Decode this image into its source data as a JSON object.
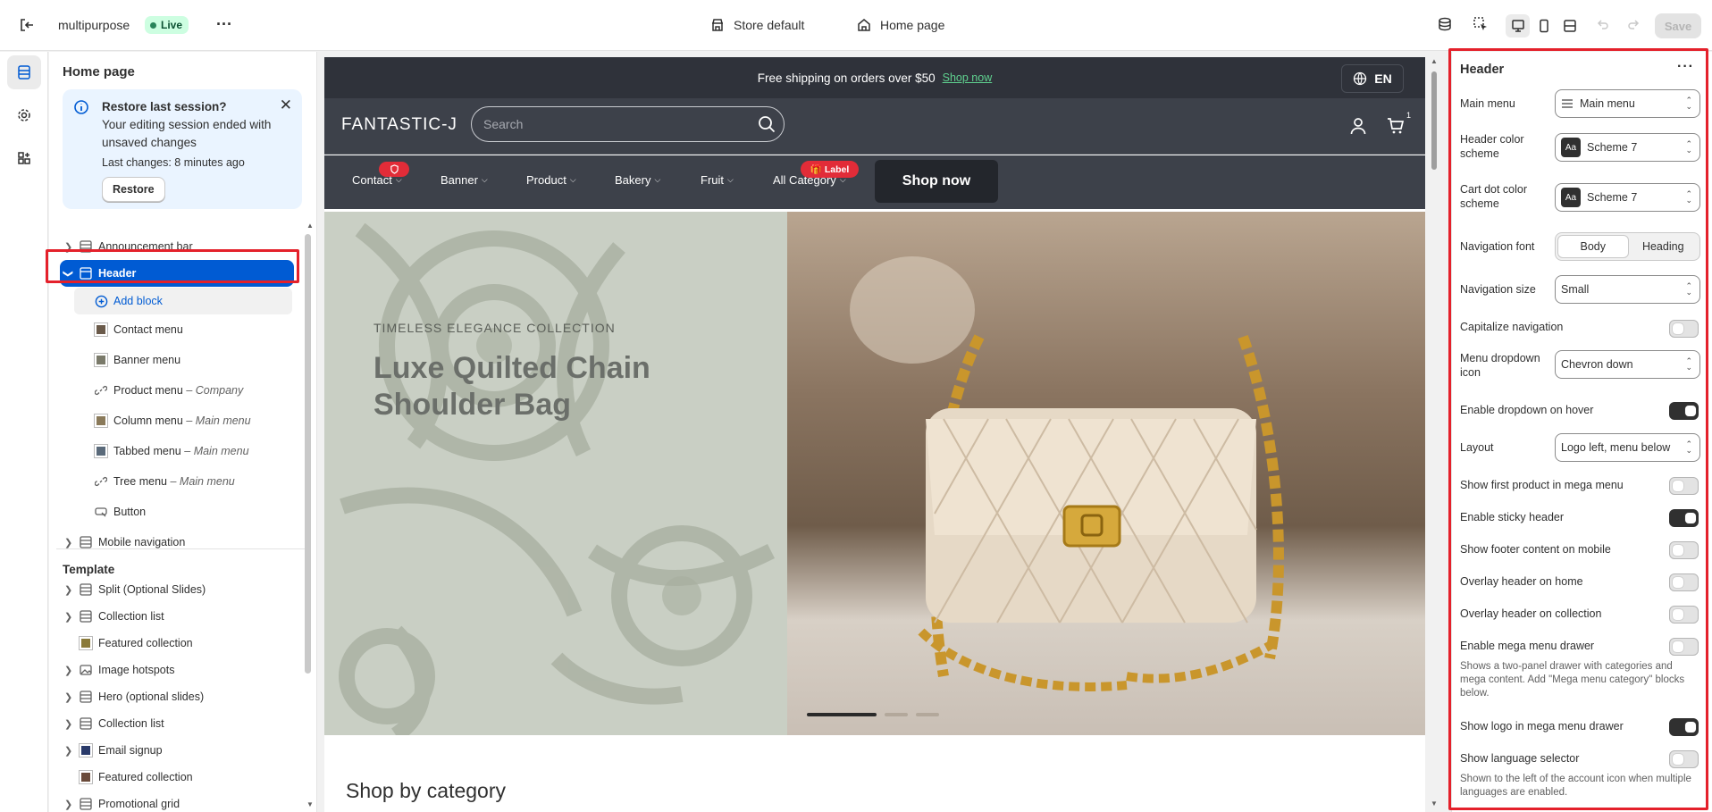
{
  "topbar": {
    "store_name": "multipurpose",
    "status_badge": "Live",
    "theme": "Store default",
    "page": "Home page",
    "save_label": "Save"
  },
  "left": {
    "title": "Home page",
    "restore": {
      "title": "Restore last session?",
      "message": "Your editing session ended with unsaved changes",
      "last_changes": "Last changes: 8 minutes ago",
      "button": "Restore"
    },
    "sections": [
      {
        "label": "Announcement bar"
      },
      {
        "label": "Header"
      },
      {
        "label": "Add block"
      },
      {
        "label": "Contact menu"
      },
      {
        "label": "Banner menu"
      },
      {
        "label": "Product menu",
        "sub": "Company"
      },
      {
        "label": "Column menu",
        "sub": "Main menu"
      },
      {
        "label": "Tabbed menu",
        "sub": "Main menu"
      },
      {
        "label": "Tree menu",
        "sub": "Main menu"
      },
      {
        "label": "Button"
      },
      {
        "label": "Mobile navigation"
      }
    ],
    "template_title": "Template",
    "template": [
      {
        "label": "Split (Optional Slides)"
      },
      {
        "label": "Collection list"
      },
      {
        "label": "Featured collection"
      },
      {
        "label": "Image hotspots"
      },
      {
        "label": "Hero (optional slides)"
      },
      {
        "label": "Collection list"
      },
      {
        "label": "Email signup"
      },
      {
        "label": "Featured collection"
      },
      {
        "label": "Promotional grid"
      }
    ]
  },
  "preview": {
    "announcement": "Free shipping on orders over $50",
    "announcement_link": "Shop now",
    "language": "EN",
    "logo": "FANTASTIC-J",
    "search_placeholder": "Search",
    "cart_count": "1",
    "nav": [
      "Contact",
      "Banner",
      "Product",
      "Bakery",
      "Fruit",
      "All Category"
    ],
    "nav_badge": "Label",
    "shop_now": "Shop now",
    "hero_kicker": "TIMELESS ELEGANCE COLLECTION",
    "hero_title": "Luxe Quilted Chain Shoulder Bag",
    "section_title": "Shop by category",
    "slides_total": 3,
    "slide_active": 1
  },
  "settings": {
    "title": "Header",
    "main_menu_label": "Main menu",
    "main_menu_value": "Main menu",
    "header_scheme_label": "Header color scheme",
    "header_scheme_value": "Scheme 7",
    "cart_scheme_label": "Cart dot color scheme",
    "cart_scheme_value": "Scheme 7",
    "scheme_icon_text": "Aa",
    "nav_font_label": "Navigation font",
    "nav_font_options": [
      "Body",
      "Heading"
    ],
    "nav_font_selected": "Body",
    "nav_size_label": "Navigation size",
    "nav_size_value": "Small",
    "capitalize_label": "Capitalize navigation",
    "capitalize": false,
    "dropdown_icon_label": "Menu dropdown icon",
    "dropdown_icon_value": "Chevron down",
    "dropdown_hover_label": "Enable dropdown on hover",
    "dropdown_hover": true,
    "layout_label": "Layout",
    "layout_value": "Logo left, menu below",
    "first_product_label": "Show first product in mega menu",
    "first_product": false,
    "sticky_label": "Enable sticky header",
    "sticky": true,
    "footer_mobile_label": "Show footer content on mobile",
    "footer_mobile": false,
    "overlay_home_label": "Overlay header on home",
    "overlay_home": false,
    "overlay_collection_label": "Overlay header on collection",
    "overlay_collection": false,
    "mega_drawer_label": "Enable mega menu drawer",
    "mega_drawer": false,
    "mega_drawer_help": "Shows a two-panel drawer with categories and mega content. Add \"Mega menu category\" blocks below.",
    "logo_drawer_label": "Show logo in mega menu drawer",
    "logo_drawer": true,
    "lang_selector_label": "Show language selector",
    "lang_selector": false,
    "lang_selector_help": "Shown to the left of the account icon when multiple languages are enabled."
  }
}
